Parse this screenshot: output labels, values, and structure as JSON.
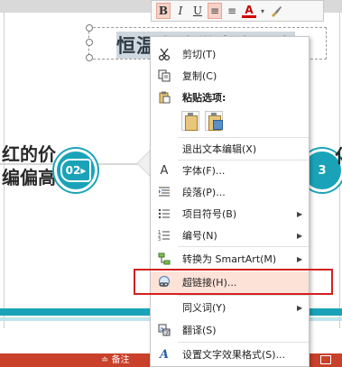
{
  "slide": {
    "title_text": "恒温瓷砖带来家不亮",
    "left_text_line1": "红的价",
    "left_text_line2": "编偏高",
    "right_text_line1": "化",
    "right_text_line2": "",
    "badge_left": "02",
    "badge_right": "3",
    "accent_color": "#1aa3b8"
  },
  "mini_toolbar": {
    "bold": "B",
    "italic": "I",
    "underline": "U",
    "align_center": "≡",
    "align_left": "≡",
    "font_color": "A",
    "dropdown": "▾",
    "highlight_icon": "brush-icon"
  },
  "context_menu": {
    "items": [
      {
        "label": "剪切(T)",
        "icon": "scissors-icon"
      },
      {
        "label": "复制(C)",
        "icon": "copy-icon"
      },
      {
        "label": "粘贴选项:",
        "icon": "paste-icon"
      },
      {
        "label": "退出文本编辑(X)",
        "icon": ""
      },
      {
        "label": "字体(F)...",
        "icon": "font-icon"
      },
      {
        "label": "段落(P)...",
        "icon": "paragraph-icon"
      },
      {
        "label": "项目符号(B)",
        "icon": "bullets-icon"
      },
      {
        "label": "编号(N)",
        "icon": "numbering-icon"
      },
      {
        "label": "转换为 SmartArt(M)",
        "icon": "smartart-icon"
      },
      {
        "label": "超链接(H)...",
        "icon": "hyperlink-icon"
      },
      {
        "label": "同义词(Y)",
        "icon": ""
      },
      {
        "label": "翻译(S)",
        "icon": "translate-icon"
      },
      {
        "label": "设置文字效果格式(S)...",
        "icon": "text-effects-icon"
      }
    ],
    "submenu_arrow": "▶",
    "highlight_color": "#d32020"
  },
  "status_bar": {
    "notes_label": "≐ 备注",
    "color": "#c9402b"
  }
}
